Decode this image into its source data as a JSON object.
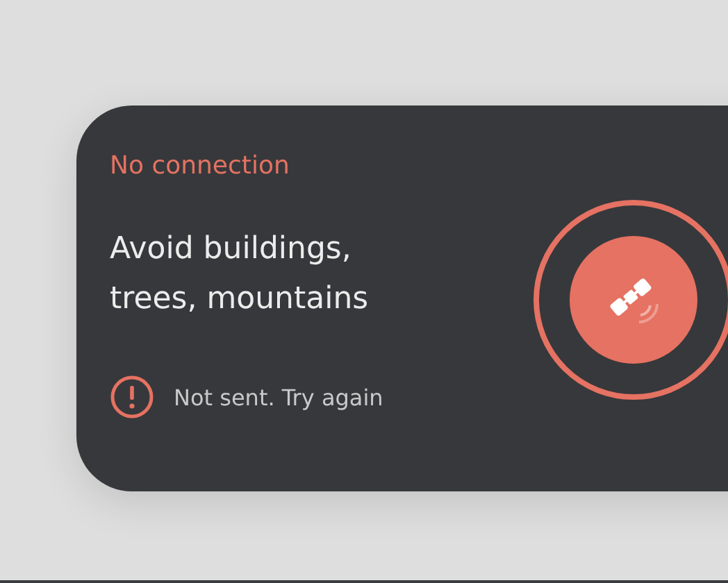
{
  "card": {
    "status": "No connection",
    "headline_lines": [
      "Avoid buildings,",
      "trees, mountains"
    ],
    "alert": {
      "kind": "error",
      "message": "Not sent. Try again"
    },
    "satellite": {
      "connected": false
    }
  }
}
